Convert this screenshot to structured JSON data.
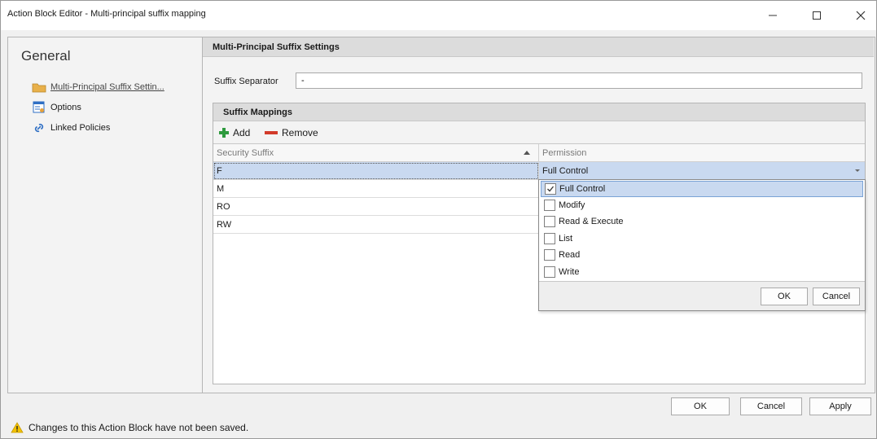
{
  "window": {
    "title": "Action Block Editor - Multi-principal suffix mapping"
  },
  "nav": {
    "header": "General",
    "items": [
      {
        "label": "Multi-Principal Suffix Settin...",
        "icon": "folder-icon",
        "active": true
      },
      {
        "label": "Options",
        "icon": "options-icon",
        "active": false
      },
      {
        "label": "Linked Policies",
        "icon": "link-icon",
        "active": false
      }
    ]
  },
  "settings": {
    "section_title": "Multi-Principal Suffix Settings",
    "separator_label": "Suffix Separator",
    "separator_value": "-"
  },
  "mappings": {
    "title": "Suffix Mappings",
    "add_label": "Add",
    "remove_label": "Remove",
    "columns": [
      "Security Suffix",
      "Permission"
    ],
    "rows": [
      {
        "suffix": "F",
        "permission": "Full Control"
      },
      {
        "suffix": "M",
        "permission": ""
      },
      {
        "suffix": "RO",
        "permission": ""
      },
      {
        "suffix": "RW",
        "permission": ""
      }
    ]
  },
  "permission_dropdown": {
    "options": [
      {
        "label": "Full Control",
        "checked": true
      },
      {
        "label": "Modify",
        "checked": false
      },
      {
        "label": "Read & Execute",
        "checked": false
      },
      {
        "label": "List",
        "checked": false
      },
      {
        "label": "Read",
        "checked": false
      },
      {
        "label": "Write",
        "checked": false
      }
    ],
    "ok_label": "OK",
    "cancel_label": "Cancel"
  },
  "footer": {
    "ok_label": "OK",
    "cancel_label": "Cancel",
    "apply_label": "Apply"
  },
  "status": {
    "message": "Changes to this Action Block have not been saved."
  },
  "colors": {
    "selection": "#c9d9f0",
    "add_green": "#2e9a3e",
    "remove_red": "#d23a2a",
    "warning_yellow": "#f2c200"
  }
}
